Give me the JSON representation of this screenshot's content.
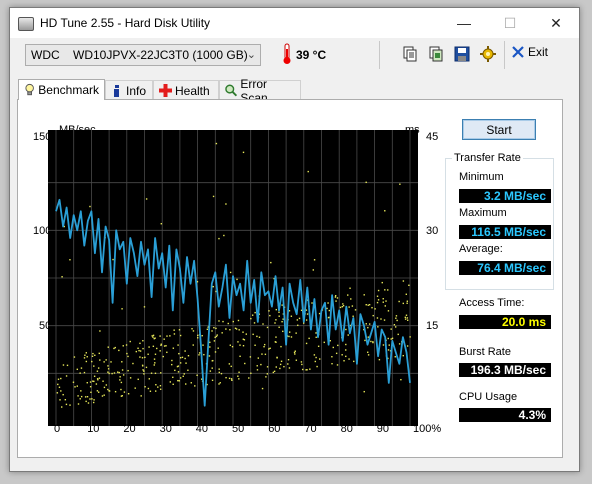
{
  "window": {
    "title": "HD Tune 2.55 - Hard Disk Utility",
    "minimize": "—",
    "maximize": "☐",
    "close": "✕"
  },
  "toolbar": {
    "drive_brand": "WDC",
    "drive_model": "WD10JPVX-22JC3T0 (1000 GB)",
    "temperature": "39 °C",
    "exit_label": "Exit",
    "icons": [
      "copy-text-icon",
      "copy-screenshot-icon",
      "save-icon",
      "options-icon",
      "exit-icon"
    ]
  },
  "tabs": [
    {
      "label": "Benchmark",
      "icon": "lightbulb-icon",
      "active": true
    },
    {
      "label": "Info",
      "icon": "info-icon",
      "active": false
    },
    {
      "label": "Health",
      "icon": "health-cross-icon",
      "active": false
    },
    {
      "label": "Error Scan",
      "icon": "magnifier-icon",
      "active": false
    }
  ],
  "benchmark": {
    "start_label": "Start",
    "transfer_rate_title": "Transfer Rate",
    "minimum_label": "Minimum",
    "minimum_value": "3.2 MB/sec",
    "maximum_label": "Maximum",
    "maximum_value": "116.5 MB/sec",
    "average_label": "Average:",
    "average_value": "76.4 MB/sec",
    "access_time_label": "Access Time:",
    "access_time_value": "20.0 ms",
    "burst_rate_label": "Burst Rate",
    "burst_rate_value": "196.3 MB/sec",
    "cpu_usage_label": "CPU Usage",
    "cpu_usage_value": "4.3%"
  },
  "colors": {
    "transfer_line": "#2a9fd6",
    "access_dots": "#e8e85a",
    "grid": "#4a4a4a",
    "plot_bg": "#000000"
  },
  "chart_data": {
    "type": "line",
    "left_axis_label": "MB/sec",
    "right_axis_label": "ms",
    "left_ticks": [
      "150",
      "100",
      "50"
    ],
    "right_ticks": [
      "45",
      "30",
      "15"
    ],
    "x_ticks": [
      "0",
      "10",
      "20",
      "30",
      "40",
      "50",
      "60",
      "70",
      "80",
      "90",
      "100%"
    ],
    "xlim": [
      0,
      100
    ],
    "ylim_left": [
      0,
      150
    ],
    "ylim_right": [
      0,
      45
    ],
    "grid": true,
    "series": [
      {
        "name": "Transfer Rate",
        "color": "#2a9fd6",
        "x": [
          0,
          1,
          2,
          3,
          4,
          5,
          6,
          7,
          8,
          9,
          10,
          11,
          12,
          13,
          14,
          15,
          16,
          17,
          18,
          19,
          20,
          21,
          22,
          23,
          24,
          25,
          26,
          27,
          28,
          29,
          30,
          31,
          32,
          33,
          34,
          35,
          36,
          37,
          38,
          39,
          40,
          41,
          42,
          43,
          44,
          45,
          46,
          47,
          48,
          49,
          50,
          51,
          52,
          53,
          54,
          55,
          56,
          57,
          58,
          59,
          60,
          61,
          62,
          63,
          64,
          65,
          66,
          67,
          68,
          69,
          70,
          71,
          72,
          73,
          74,
          75,
          76,
          77,
          78,
          79,
          80,
          81,
          82,
          83,
          84,
          85,
          86,
          87,
          88,
          89,
          90,
          91,
          92,
          93,
          94,
          95,
          96,
          97,
          98,
          99,
          100
        ],
        "y": [
          110,
          116,
          102,
          112,
          96,
          108,
          100,
          110,
          92,
          105,
          110,
          88,
          106,
          78,
          102,
          95,
          62,
          100,
          90,
          94,
          72,
          96,
          88,
          76,
          94,
          82,
          90,
          65,
          96,
          80,
          88,
          70,
          92,
          58,
          90,
          80,
          62,
          86,
          72,
          84,
          64,
          38,
          8,
          40,
          72,
          78,
          60,
          70,
          82,
          54,
          76,
          66,
          72,
          58,
          84,
          62,
          74,
          52,
          78,
          66,
          68,
          60,
          76,
          58,
          70,
          40,
          72,
          62,
          56,
          74,
          52,
          70,
          48,
          64,
          44,
          58,
          62,
          40,
          66,
          48,
          58,
          42,
          60,
          46,
          54,
          30,
          56,
          50,
          40,
          46,
          52,
          34,
          48,
          44,
          20,
          42,
          36,
          30,
          44,
          36,
          20
        ]
      },
      {
        "name": "Access Time",
        "color": "#e8e85a",
        "type": "scatter",
        "unit": "ms",
        "summary_range_ms": [
          3,
          26
        ]
      }
    ]
  }
}
